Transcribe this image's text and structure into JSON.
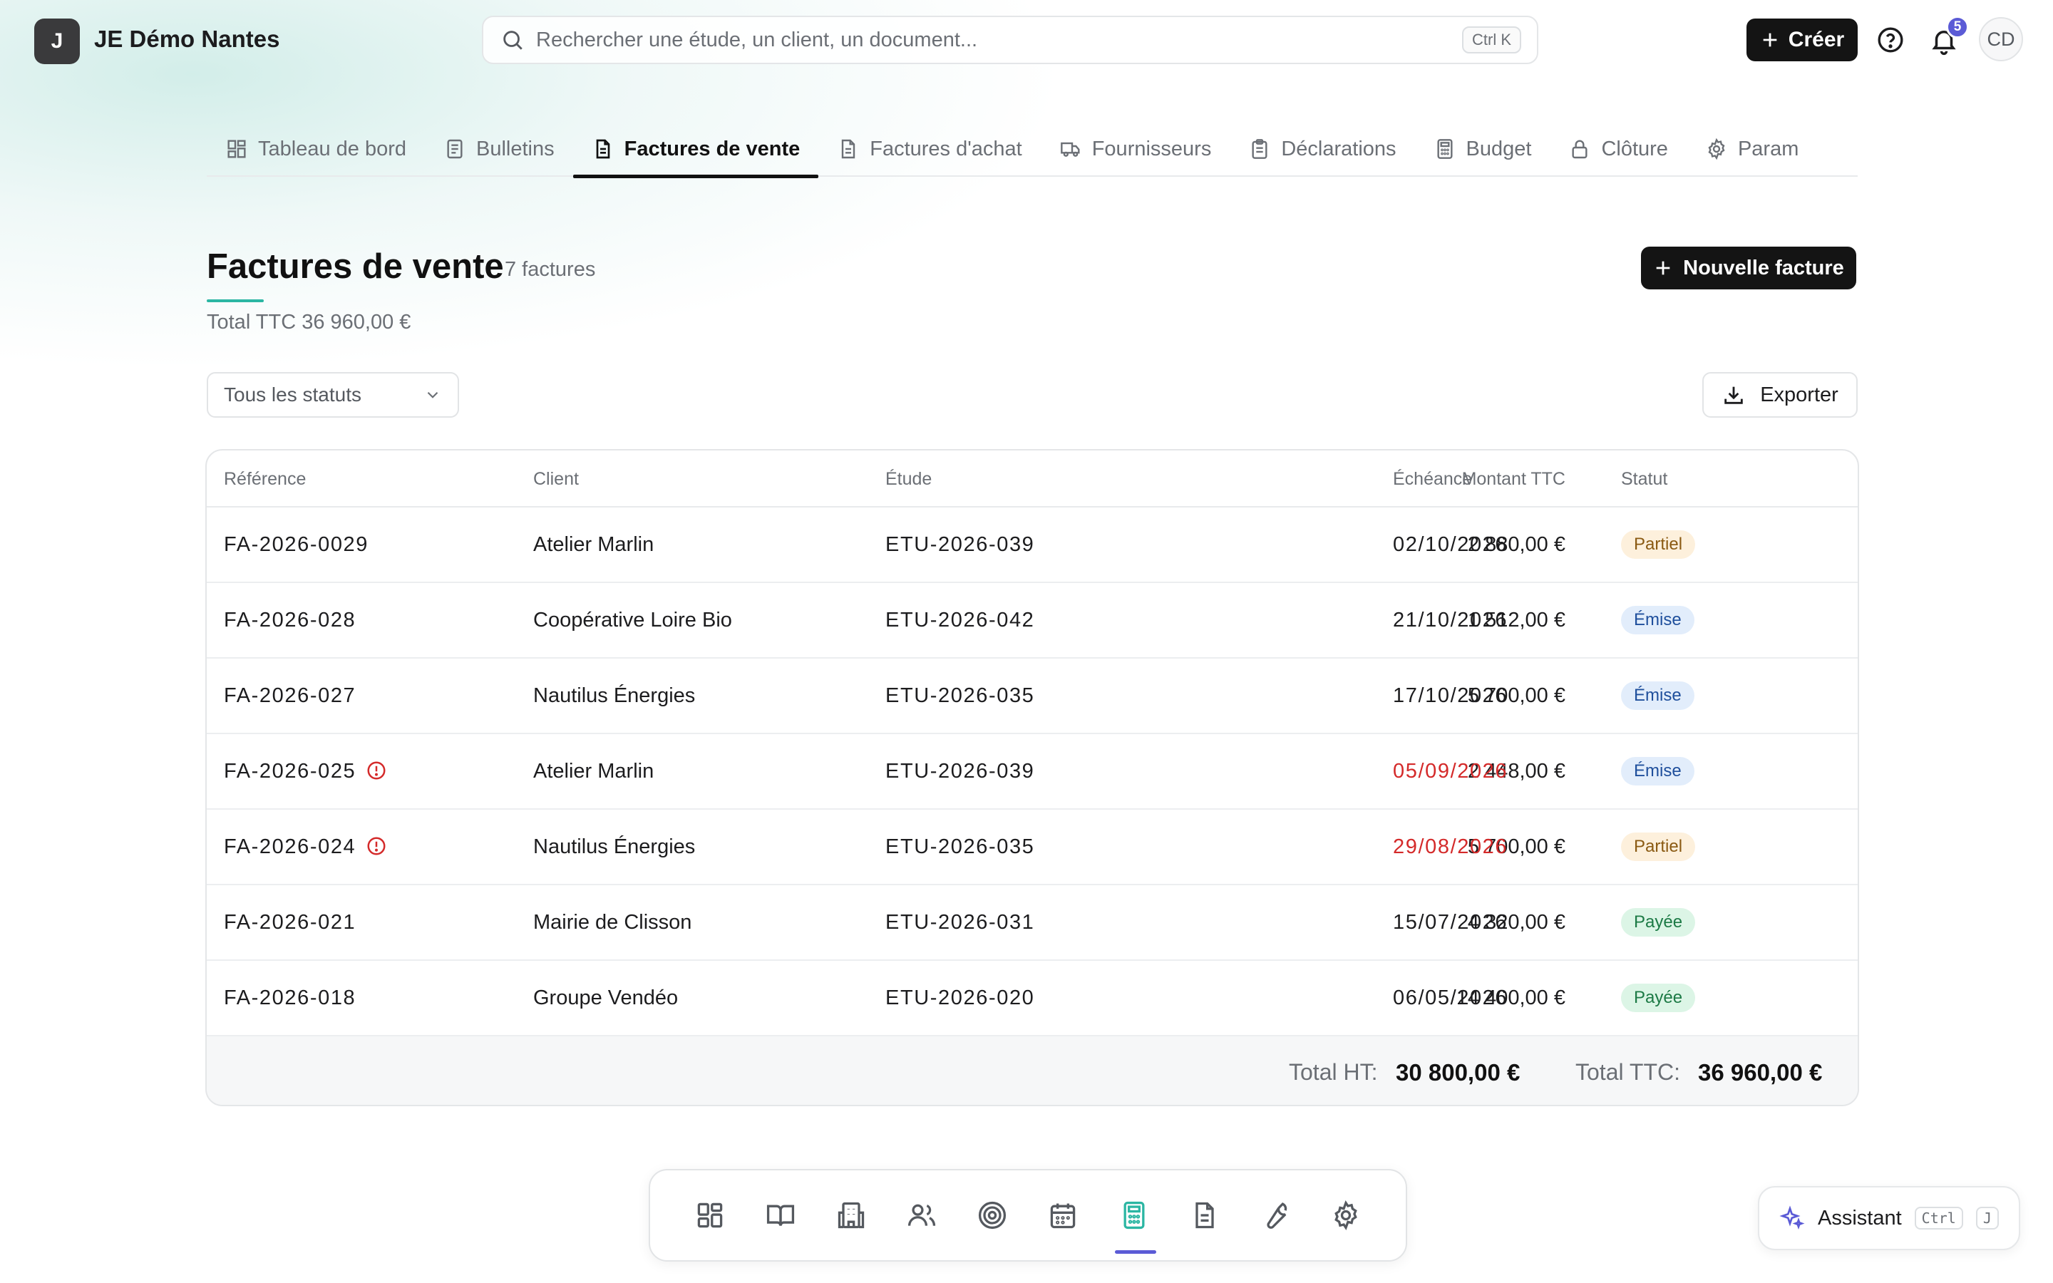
{
  "app": {
    "logo_letter": "J",
    "name": "JE Démo Nantes"
  },
  "search": {
    "placeholder": "Rechercher une étude, un client, un document...",
    "shortcut": "Ctrl K"
  },
  "header": {
    "create_label": "Créer",
    "notifications_count": "5",
    "avatar_initials": "CD"
  },
  "tabs": [
    {
      "label": "Tableau de bord",
      "icon": "dashboard-icon"
    },
    {
      "label": "Bulletins",
      "icon": "document-icon"
    },
    {
      "label": "Factures de vente",
      "icon": "invoice-icon",
      "active": true
    },
    {
      "label": "Factures d'achat",
      "icon": "invoice-icon"
    },
    {
      "label": "Fournisseurs",
      "icon": "truck-icon"
    },
    {
      "label": "Déclarations",
      "icon": "clipboard-icon"
    },
    {
      "label": "Budget",
      "icon": "calculator-icon"
    },
    {
      "label": "Clôture",
      "icon": "lock-icon"
    },
    {
      "label": "Param",
      "icon": "gear-icon"
    }
  ],
  "page": {
    "title": "Factures de vente",
    "count": "7 factures",
    "total": "Total TTC 36 960,00 €",
    "new_button": "Nouvelle facture",
    "filter_value": "Tous les statuts",
    "export_button": "Exporter"
  },
  "table": {
    "headers": [
      "Référence",
      "Client",
      "Étude",
      "Montant TTC",
      "Échéance",
      "Statut"
    ],
    "rows": [
      {
        "ref": "FA-2026-0029",
        "client": "Atelier Marlin",
        "etude": "ETU-2026-039",
        "montant": "2 880,00 €",
        "echeance": "02/10/2026",
        "statut": "Partiel",
        "overdue": false
      },
      {
        "ref": "FA-2026-028",
        "client": "Coopérative Loire Bio",
        "etude": "ETU-2026-042",
        "montant": "1 512,00 €",
        "echeance": "21/10/2026",
        "statut": "Émise",
        "overdue": false
      },
      {
        "ref": "FA-2026-027",
        "client": "Nautilus Énergies",
        "etude": "ETU-2026-035",
        "montant": "5 700,00 €",
        "echeance": "17/10/2026",
        "statut": "Émise",
        "overdue": false
      },
      {
        "ref": "FA-2026-025",
        "client": "Atelier Marlin",
        "etude": "ETU-2026-039",
        "montant": "2 448,00 €",
        "echeance": "05/09/2026",
        "statut": "Émise",
        "overdue": true
      },
      {
        "ref": "FA-2026-024",
        "client": "Nautilus Énergies",
        "etude": "ETU-2026-035",
        "montant": "5 700,00 €",
        "echeance": "29/08/2026",
        "statut": "Partiel",
        "overdue": true
      },
      {
        "ref": "FA-2026-021",
        "client": "Mairie de Clisson",
        "etude": "ETU-2026-031",
        "montant": "4 320,00 €",
        "echeance": "15/07/2026",
        "statut": "Payée",
        "overdue": false
      },
      {
        "ref": "FA-2026-018",
        "client": "Groupe Vendéo",
        "etude": "ETU-2026-020",
        "montant": "14 400,00 €",
        "echeance": "06/05/2026",
        "statut": "Payée",
        "overdue": false
      }
    ],
    "footer": {
      "ht_label": "Total HT:",
      "ht_value": "30 800,00 €",
      "ttc_label": "Total TTC:",
      "ttc_value": "36 960,00 €"
    }
  },
  "dock": {
    "items": [
      "grid-icon",
      "book-icon",
      "building-icon",
      "users-icon",
      "target-icon",
      "calendar-icon",
      "calculator-icon",
      "document-icon",
      "wrench-icon",
      "gear-icon"
    ],
    "active": "calculator-icon"
  },
  "assistant": {
    "label": "Assistant",
    "key1": "Ctrl",
    "key2": "J"
  },
  "colors": {
    "accent": "#5b5bd6",
    "teal": "#2bb6a3",
    "danger": "#d42a2a",
    "dark": "#141414"
  }
}
